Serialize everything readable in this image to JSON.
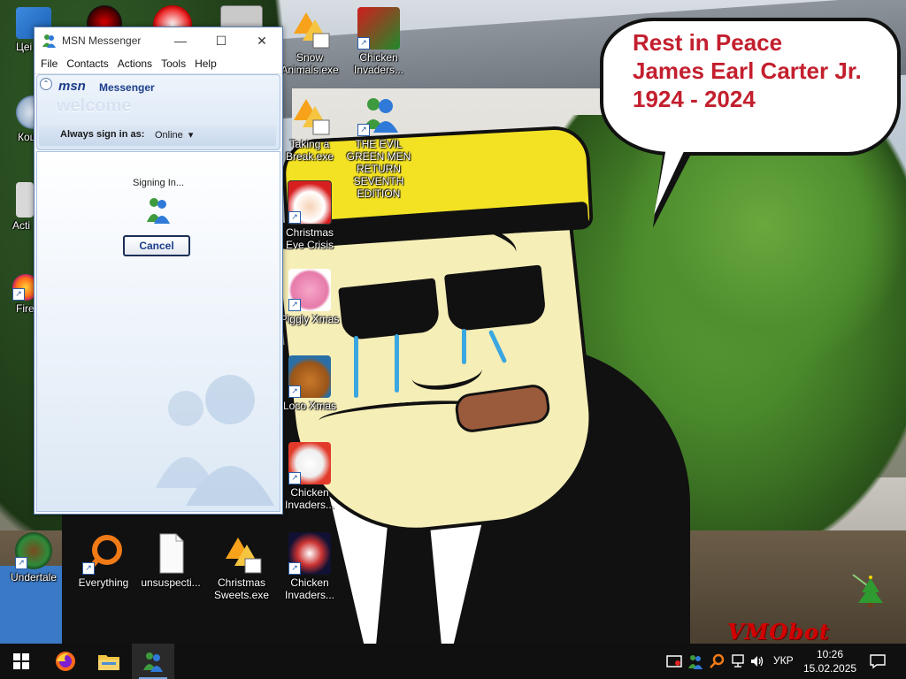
{
  "desktop": {
    "icons": [
      {
        "label": "Цеі",
        "icon": "computer-icon"
      },
      {
        "label": "",
        "icon": "red-app-icon"
      },
      {
        "label": "",
        "icon": "rss-app-icon"
      },
      {
        "label": "",
        "icon": "grey-app-icon"
      },
      {
        "label": "Snow Animals.exe",
        "icon": "snow-animals-icon"
      },
      {
        "label": "Chicken Invaders...",
        "icon": "chicken-invaders-icon"
      },
      {
        "label": "Кош",
        "icon": "recycle-bin-icon"
      },
      {
        "label": "Taking a Break.exe",
        "icon": "taking-a-break-icon"
      },
      {
        "label": "THE EVIL GREEN MEN RETURN SEVENTH EDITION",
        "icon": "msn-buddy-icon"
      },
      {
        "label": "Acti",
        "icon": "activate-icon"
      },
      {
        "label": "Christmas Eve Crisis",
        "icon": "santa-icon"
      },
      {
        "label": "Fire",
        "icon": "firefox-icon"
      },
      {
        "label": "Piggly Xmas",
        "icon": "piggy-icon"
      },
      {
        "label": "Loco Xmas",
        "icon": "bear-icon"
      },
      {
        "label": "Chicken Invaders...",
        "icon": "chicken-invaders-icon"
      },
      {
        "label": "Undertale",
        "icon": "undertale-icon"
      },
      {
        "label": "Everything",
        "icon": "everything-search-icon"
      },
      {
        "label": "unsuspecti...",
        "icon": "blank-file-icon"
      },
      {
        "label": "Christmas Sweets.exe",
        "icon": "christmas-sweets-icon"
      },
      {
        "label": "Chicken Invaders...",
        "icon": "chicken-invaders-icon"
      }
    ]
  },
  "speech_bubble": {
    "lines": [
      "Rest in Peace",
      "James Earl Carter Jr.",
      "1924 - 2024"
    ],
    "color": "#c31f2e"
  },
  "watermark": "VMObot",
  "msn": {
    "title": "MSN Messenger",
    "window_buttons": {
      "minimize": "—",
      "maximize": "☐",
      "close": "✕"
    },
    "menu": [
      "File",
      "Contacts",
      "Actions",
      "Tools",
      "Help"
    ],
    "logo": "msn",
    "logo_suffix": "Messenger",
    "welcome": "welcome",
    "sign_in_label": "Always sign in as:",
    "sign_in_status": "Online",
    "signing_in_text": "Signing In...",
    "cancel_label": "Cancel"
  },
  "taskbar": {
    "apps": [
      "start-icon",
      "firefox-icon",
      "file-explorer-icon",
      "msn-messenger-icon"
    ],
    "tray": [
      "screen-capture-icon",
      "msn-tray-icon",
      "search-tray-icon",
      "network-icon",
      "volume-icon"
    ],
    "language": "УКР",
    "time": "10:26",
    "date": "15.02.2025",
    "notification_icon": "notification-icon"
  },
  "colors": {
    "taskbar": "#101010",
    "msn_accent": "#1b3d8a",
    "bubble_text": "#c31f2e"
  }
}
